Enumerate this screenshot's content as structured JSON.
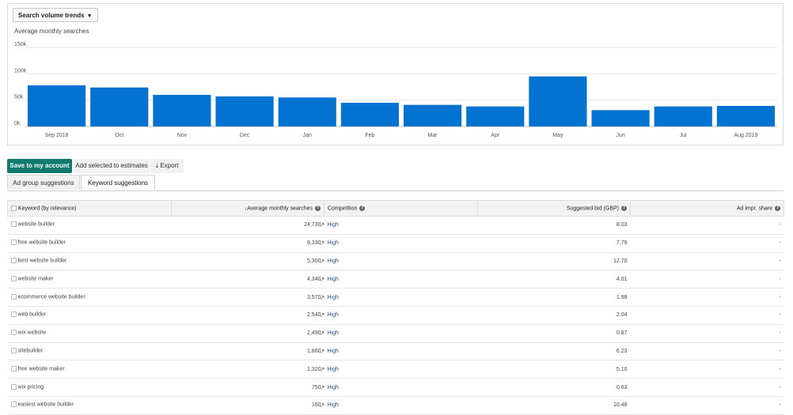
{
  "header": {
    "dropdown_label": "Search volume trends",
    "subtitle": "Average monthly searches"
  },
  "chart_data": {
    "type": "bar",
    "categories": [
      "Sep 2018",
      "Oct",
      "Nov",
      "Dec",
      "Jan",
      "Feb",
      "Mar",
      "Apr",
      "May",
      "Jun",
      "Jul",
      "Aug 2019"
    ],
    "values": [
      78000,
      74000,
      60000,
      57000,
      55000,
      45000,
      41000,
      38000,
      95000,
      31000,
      38000,
      39000
    ],
    "ylim": [
      0,
      150000
    ],
    "yticks": [
      {
        "value": 0,
        "label": "0k"
      },
      {
        "value": 50000,
        "label": "50k"
      },
      {
        "value": 100000,
        "label": "100k"
      },
      {
        "value": 150000,
        "label": "150k"
      }
    ],
    "color": "#0472d0",
    "grid": true
  },
  "toolbar": {
    "save_label": "Save to my account",
    "add_label": "Add selected to estimates",
    "export_label": "Export",
    "export_icon": "download-icon"
  },
  "tabs": [
    {
      "label": "Ad group suggestions",
      "active": false
    },
    {
      "label": "Keyword suggestions",
      "active": true
    }
  ],
  "table": {
    "columns": {
      "keyword": "Keyword (by relevance)",
      "searches": "Average monthly searches",
      "sort_arrow": "↓",
      "competition": "Competition",
      "bid": "Suggested bid (GBP)",
      "share": "Ad impr. share"
    },
    "help_icon": "?",
    "trend_icon": "↗",
    "rows": [
      {
        "keyword": "website builder",
        "searches": "24,730",
        "competition": "High",
        "bid": "8.03",
        "share": "-"
      },
      {
        "keyword": "free website builder",
        "searches": "8,330",
        "competition": "High",
        "bid": "7.79",
        "share": "-"
      },
      {
        "keyword": "best website builder",
        "searches": "5,300",
        "competition": "High",
        "bid": "12.70",
        "share": "-"
      },
      {
        "keyword": "website maker",
        "searches": "4,340",
        "competition": "High",
        "bid": "4.01",
        "share": "-"
      },
      {
        "keyword": "ecommerce website builder",
        "searches": "3,570",
        "competition": "High",
        "bid": "1.99",
        "share": "-"
      },
      {
        "keyword": "web builder",
        "searches": "2,540",
        "competition": "High",
        "bid": "2.04",
        "share": "-"
      },
      {
        "keyword": "wix website",
        "searches": "2,490",
        "competition": "High",
        "bid": "0.87",
        "share": "-"
      },
      {
        "keyword": "sitebuilder",
        "searches": "1,860",
        "competition": "High",
        "bid": "6.23",
        "share": "-"
      },
      {
        "keyword": "free website maker",
        "searches": "1,320",
        "competition": "High",
        "bid": "5.10",
        "share": "-"
      },
      {
        "keyword": "wix pricing",
        "searches": "750",
        "competition": "High",
        "bid": "0.63",
        "share": "-"
      },
      {
        "keyword": "easiest website builder",
        "searches": "160",
        "competition": "High",
        "bid": "10.48",
        "share": "-"
      }
    ]
  }
}
